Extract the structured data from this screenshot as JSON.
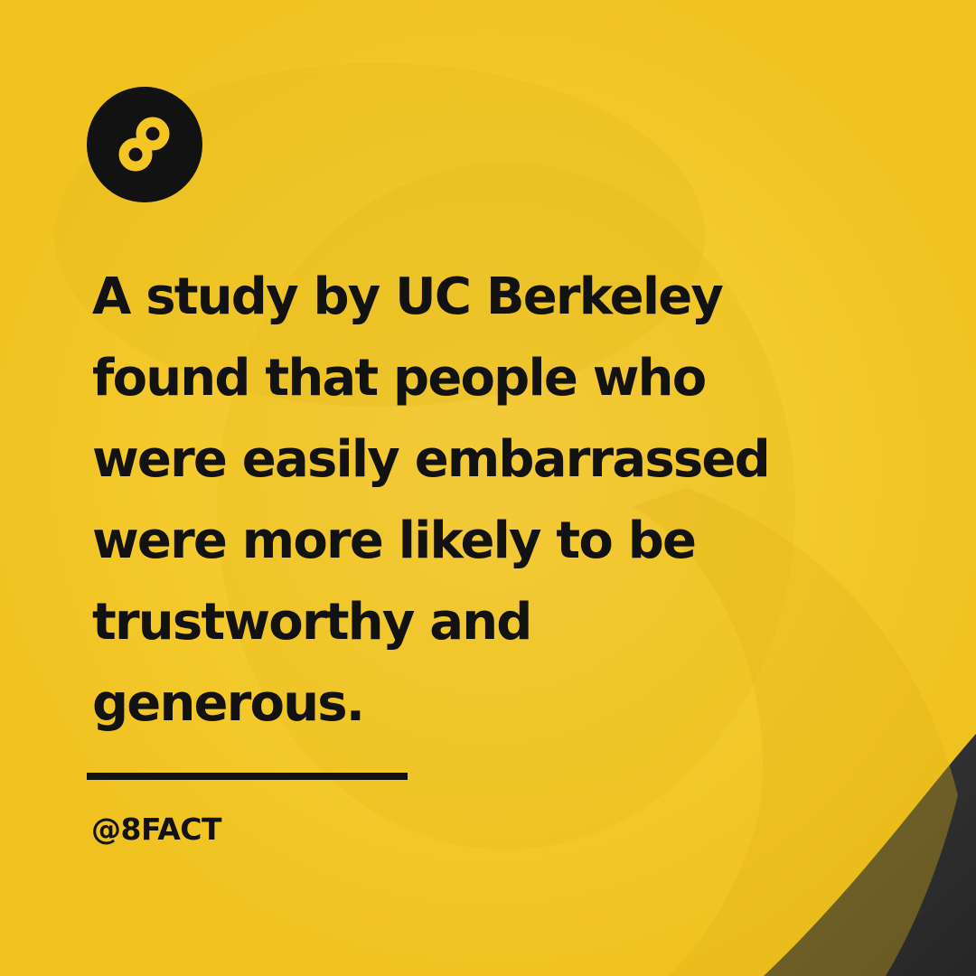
{
  "post": {
    "logo_icon": "infinity-eight-icon",
    "headline": "A study by UC Berkeley\nfound that people who\nwere easily embarrassed\nwere more likely to be\ntrustworthy and\ngenerous.",
    "handle": "@8FACT"
  },
  "colors": {
    "brand_yellow": "#f3c623",
    "text_dark": "#121212"
  }
}
